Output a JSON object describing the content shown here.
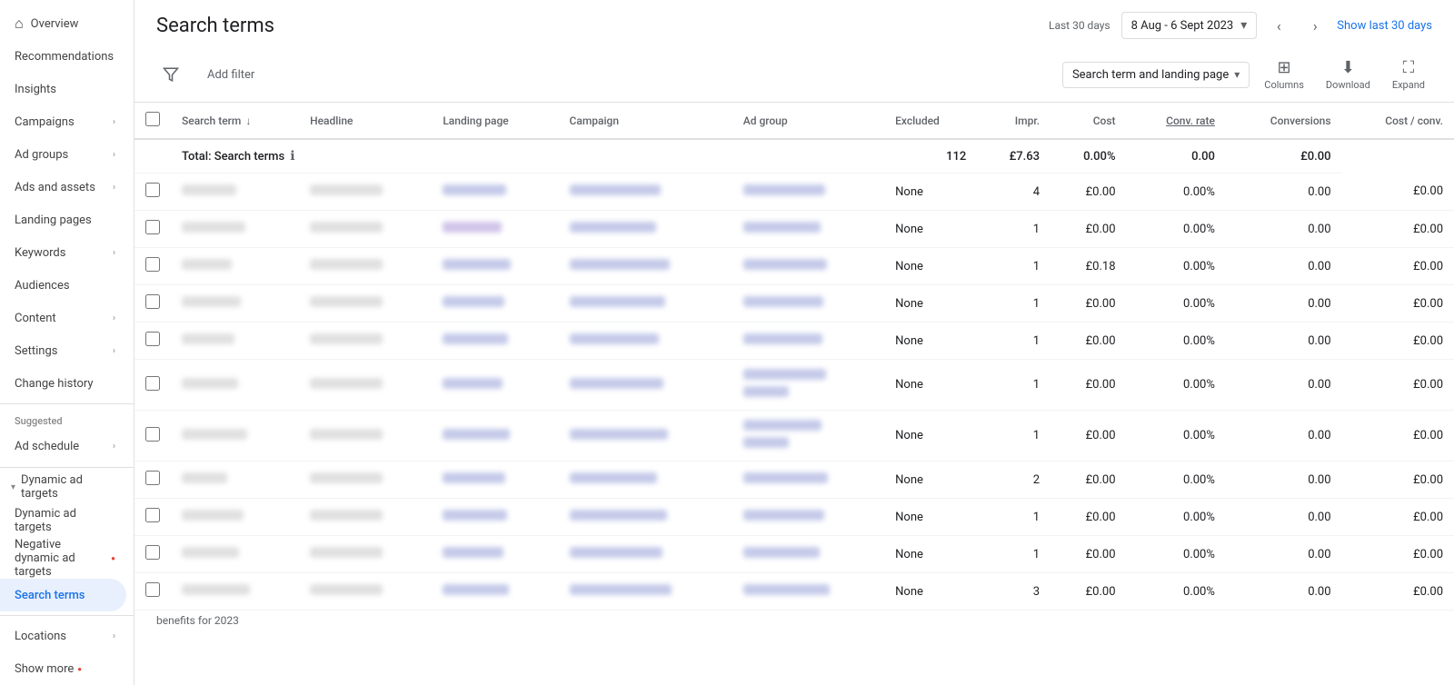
{
  "sidebar": {
    "items": [
      {
        "id": "overview",
        "label": "Overview",
        "icon": "⊞",
        "hasArrow": false,
        "active": false,
        "homeIcon": true
      },
      {
        "id": "recommendations",
        "label": "Recommendations",
        "icon": "",
        "hasArrow": false,
        "active": false
      },
      {
        "id": "insights",
        "label": "Insights",
        "icon": "",
        "hasArrow": false,
        "active": false
      },
      {
        "id": "campaigns",
        "label": "Campaigns",
        "icon": "",
        "hasArrow": true,
        "active": false
      },
      {
        "id": "ad-groups",
        "label": "Ad groups",
        "icon": "",
        "hasArrow": true,
        "active": false
      },
      {
        "id": "ads-and-assets",
        "label": "Ads and assets",
        "icon": "",
        "hasArrow": true,
        "active": false
      },
      {
        "id": "landing-pages",
        "label": "Landing pages",
        "icon": "",
        "hasArrow": false,
        "active": false
      },
      {
        "id": "keywords",
        "label": "Keywords",
        "icon": "",
        "hasArrow": true,
        "active": false
      },
      {
        "id": "audiences",
        "label": "Audiences",
        "icon": "",
        "hasArrow": false,
        "active": false
      },
      {
        "id": "content",
        "label": "Content",
        "icon": "",
        "hasArrow": true,
        "active": false
      },
      {
        "id": "settings",
        "label": "Settings",
        "icon": "",
        "hasArrow": true,
        "active": false
      },
      {
        "id": "change-history",
        "label": "Change history",
        "icon": "",
        "hasArrow": false,
        "active": false
      }
    ],
    "suggested_label": "Suggested",
    "suggested_items": [
      {
        "id": "ad-schedule",
        "label": "Ad schedule",
        "hasArrow": true
      }
    ],
    "dynamic_label": "Dynamic ad targets",
    "dynamic_items": [
      {
        "id": "dynamic-ad-targets",
        "label": "Dynamic ad targets",
        "active": false
      },
      {
        "id": "negative-dynamic",
        "label": "Negative dynamic ad targets",
        "active": false,
        "hasDot": true
      },
      {
        "id": "search-terms",
        "label": "Search terms",
        "active": true
      }
    ],
    "bottom_items": [
      {
        "id": "locations",
        "label": "Locations",
        "hasArrow": true
      },
      {
        "id": "show-more",
        "label": "Show more",
        "hasDot": true
      }
    ]
  },
  "header": {
    "title": "Search terms",
    "date_label": "Last 30 days",
    "date_range": "8 Aug - 6 Sept 2023",
    "show_last": "Show last 30 days"
  },
  "toolbar": {
    "filter_label": "Add filter",
    "view_label": "Search term and landing page",
    "columns_label": "Columns",
    "download_label": "Download",
    "expand_label": "Expand"
  },
  "table": {
    "columns": [
      {
        "id": "search-term",
        "label": "Search term",
        "sortable": true,
        "numeric": false
      },
      {
        "id": "headline",
        "label": "Headline",
        "sortable": false,
        "numeric": false
      },
      {
        "id": "landing-page",
        "label": "Landing page",
        "sortable": false,
        "numeric": false
      },
      {
        "id": "campaign",
        "label": "Campaign",
        "sortable": false,
        "numeric": false
      },
      {
        "id": "ad-group",
        "label": "Ad group",
        "sortable": false,
        "numeric": false
      },
      {
        "id": "excluded",
        "label": "Excluded",
        "sortable": false,
        "numeric": false
      },
      {
        "id": "impr",
        "label": "Impr.",
        "sortable": false,
        "numeric": true
      },
      {
        "id": "cost",
        "label": "Cost",
        "sortable": false,
        "numeric": true
      },
      {
        "id": "conv-rate",
        "label": "Conv. rate",
        "sortable": false,
        "numeric": true,
        "underline": true
      },
      {
        "id": "conversions",
        "label": "Conversions",
        "sortable": false,
        "numeric": true
      },
      {
        "id": "cost-conv",
        "label": "Cost / conv.",
        "sortable": false,
        "numeric": true
      }
    ],
    "total_row": {
      "label": "Total: Search terms",
      "impr": "112",
      "cost": "£7.63",
      "conv_rate": "0.00%",
      "conversions": "0.00",
      "cost_conv": "£0.00"
    },
    "rows": [
      {
        "excluded": "None",
        "impr": "4",
        "cost": "£0.00",
        "conv_rate": "0.00%",
        "conversions": "0.00",
        "cost_conv": "£0.00"
      },
      {
        "excluded": "None",
        "impr": "1",
        "cost": "£0.00",
        "conv_rate": "0.00%",
        "conversions": "0.00",
        "cost_conv": "£0.00"
      },
      {
        "excluded": "None",
        "impr": "1",
        "cost": "£0.18",
        "conv_rate": "0.00%",
        "conversions": "0.00",
        "cost_conv": "£0.00"
      },
      {
        "excluded": "None",
        "impr": "1",
        "cost": "£0.00",
        "conv_rate": "0.00%",
        "conversions": "0.00",
        "cost_conv": "£0.00"
      },
      {
        "excluded": "None",
        "impr": "1",
        "cost": "£0.00",
        "conv_rate": "0.00%",
        "conversions": "0.00",
        "cost_conv": "£0.00"
      },
      {
        "excluded": "None",
        "impr": "1",
        "cost": "£0.00",
        "conv_rate": "0.00%",
        "conversions": "0.00",
        "cost_conv": "£0.00"
      },
      {
        "excluded": "None",
        "impr": "1",
        "cost": "£0.00",
        "conv_rate": "0.00%",
        "conversions": "0.00",
        "cost_conv": "£0.00"
      },
      {
        "excluded": "None",
        "impr": "2",
        "cost": "£0.00",
        "conv_rate": "0.00%",
        "conversions": "0.00",
        "cost_conv": "£0.00"
      },
      {
        "excluded": "None",
        "impr": "1",
        "cost": "£0.00",
        "conv_rate": "0.00%",
        "conversions": "0.00",
        "cost_conv": "£0.00"
      },
      {
        "excluded": "None",
        "impr": "1",
        "cost": "£0.00",
        "conv_rate": "0.00%",
        "conversions": "0.00",
        "cost_conv": "£0.00"
      },
      {
        "excluded": "None",
        "impr": "3",
        "cost": "£0.00",
        "conv_rate": "0.00%",
        "conversions": "0.00",
        "cost_conv": "£0.00"
      }
    ],
    "footer_text": "benefits for 2023"
  },
  "colors": {
    "accent": "#1a73e8",
    "active_bg": "#e8f0fe",
    "border": "#e0e0e0",
    "muted": "#5f6368"
  }
}
